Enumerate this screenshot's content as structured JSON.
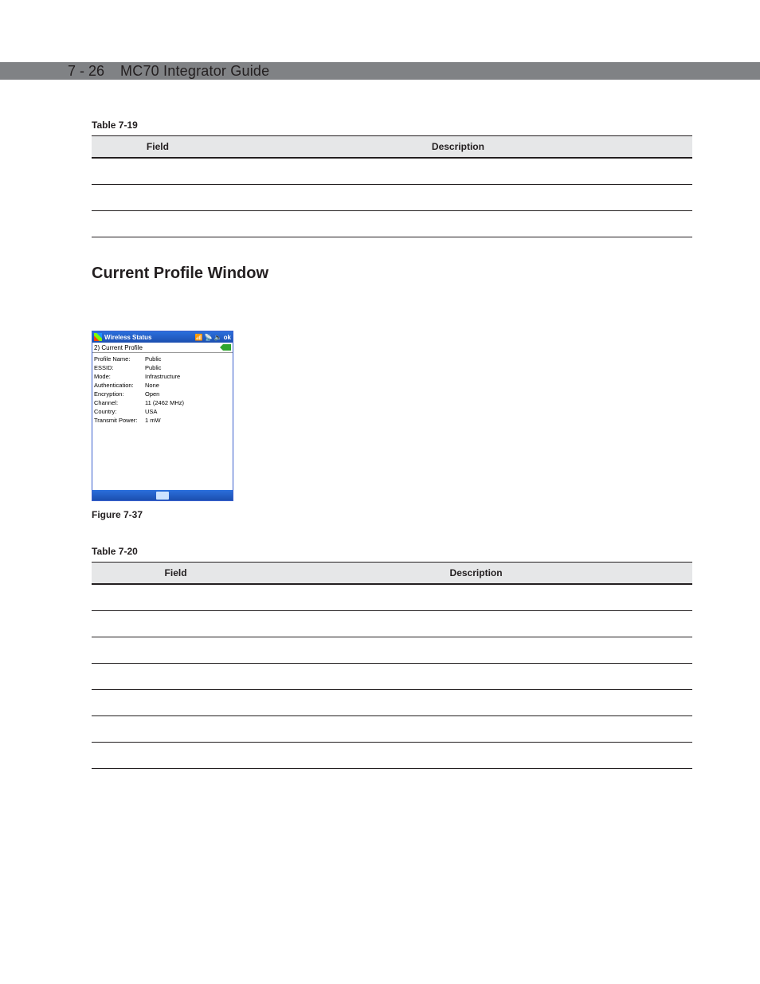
{
  "header": {
    "page_number": "7 - 26",
    "doc_title": "MC70 Integrator Guide"
  },
  "table1": {
    "caption": "Table 7-19",
    "col_field": "Field",
    "col_desc": "Description"
  },
  "section_title": "Current Profile Window",
  "screenshot": {
    "title": "Wireless Status",
    "ok": "ok",
    "subtitle": "2) Current Profile",
    "rows": [
      {
        "k": "Profile Name:",
        "v": "Public"
      },
      {
        "k": "ESSID:",
        "v": "Public"
      },
      {
        "k": "Mode:",
        "v": "Infrastructure"
      },
      {
        "k": "Authentication:",
        "v": "None"
      },
      {
        "k": "Encryption:",
        "v": "Open"
      },
      {
        "k": "Channel:",
        "v": "11 (2462 MHz)"
      },
      {
        "k": "Country:",
        "v": "USA"
      },
      {
        "k": "Transmit Power:",
        "v": "1 mW"
      }
    ]
  },
  "figure_caption": "Figure 7-37",
  "table2": {
    "caption": "Table 7-20",
    "col_field": "Field",
    "col_desc": "Description"
  }
}
